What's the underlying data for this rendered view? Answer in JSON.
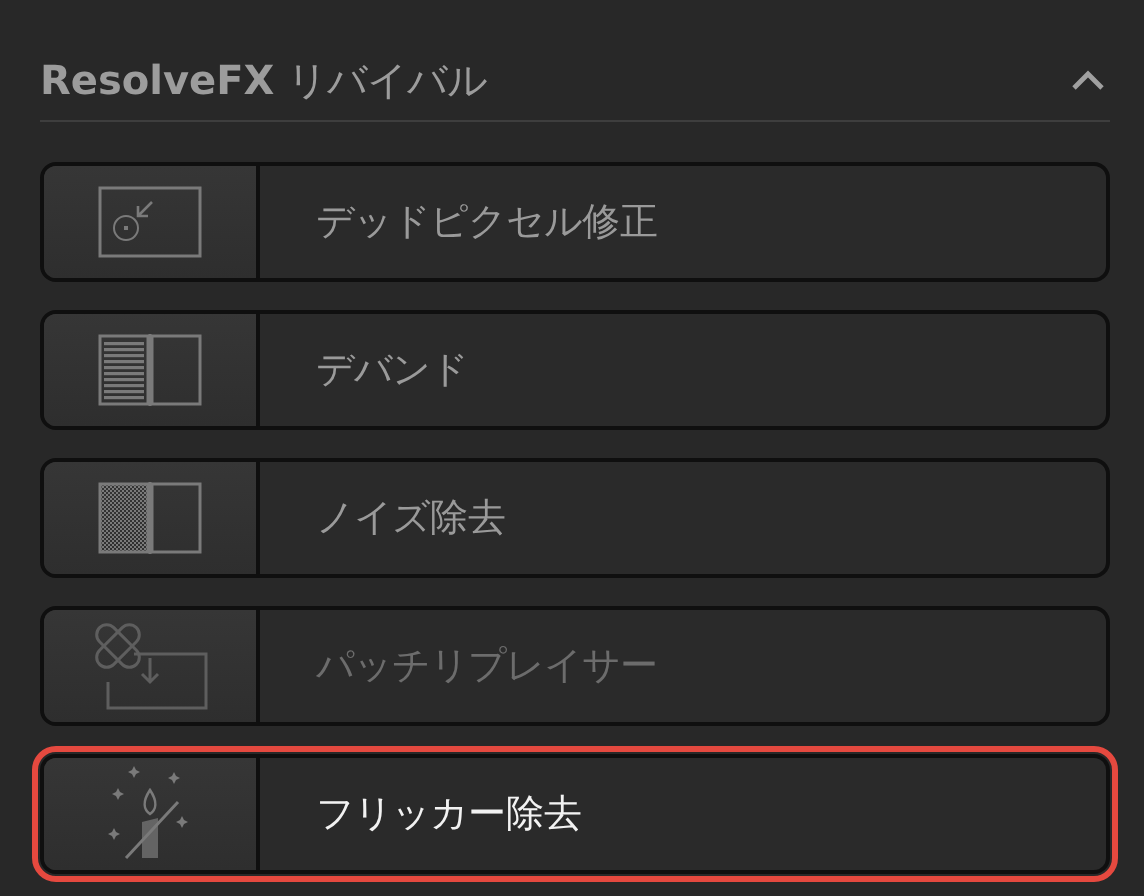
{
  "section": {
    "title": "**ResolveFX** リバイバル",
    "expanded": true
  },
  "effects": [
    {
      "kind": "dead-pixel",
      "label": "デッドピクセル修正",
      "selected": false,
      "disabled": false
    },
    {
      "kind": "deband",
      "label": "デバンド",
      "selected": false,
      "disabled": false
    },
    {
      "kind": "noise",
      "label": "ノイズ除去",
      "selected": false,
      "disabled": false
    },
    {
      "kind": "patch",
      "label": "パッチリプレイサー",
      "selected": false,
      "disabled": true
    },
    {
      "kind": "flicker",
      "label": "フリッカー除去",
      "selected": true,
      "disabled": false
    }
  ]
}
